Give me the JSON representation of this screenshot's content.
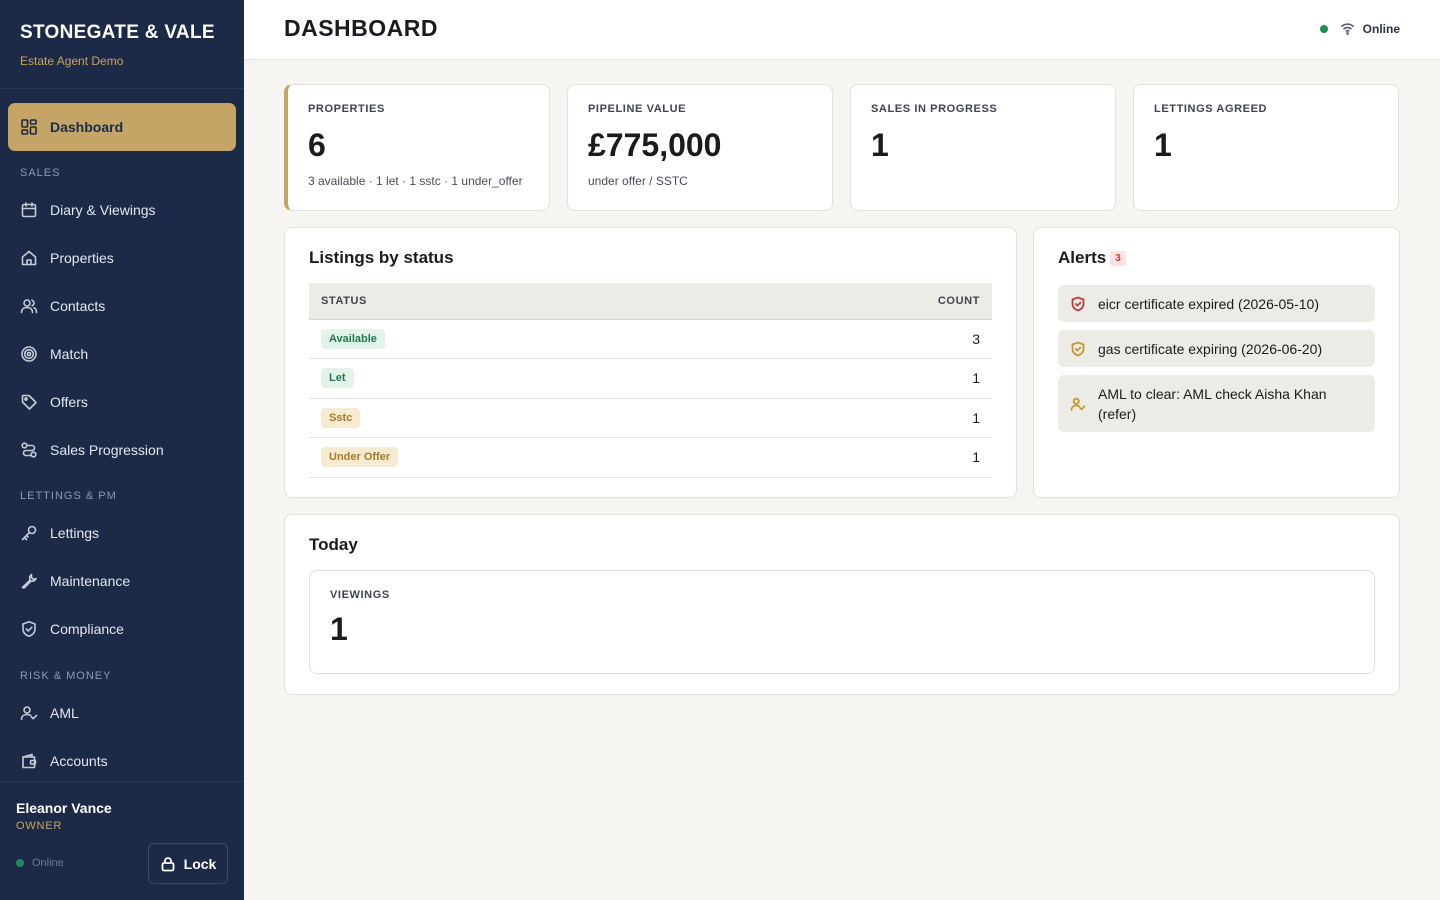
{
  "brand": {
    "title": "STONEGATE & VALE",
    "subtitle": "Estate Agent Demo"
  },
  "nav": {
    "dashboard": "Dashboard",
    "sales_section": "SALES",
    "diary": "Diary & Viewings",
    "properties": "Properties",
    "contacts": "Contacts",
    "match": "Match",
    "offers": "Offers",
    "sales_progression": "Sales Progression",
    "lettings_section": "LETTINGS & PM",
    "lettings": "Lettings",
    "maintenance": "Maintenance",
    "compliance": "Compliance",
    "risk_section": "RISK & MONEY",
    "aml": "AML",
    "accounts": "Accounts"
  },
  "user": {
    "name": "Eleanor Vance",
    "role": "OWNER",
    "status": "Online",
    "lock_label": "Lock"
  },
  "header": {
    "title": "DASHBOARD",
    "status": "Online"
  },
  "stats": {
    "properties": {
      "label": "PROPERTIES",
      "value": "6",
      "sub": "3 available · 1 let · 1 sstc · 1 under_offer"
    },
    "pipeline": {
      "label": "PIPELINE VALUE",
      "value": "£775,000",
      "sub": "under offer / SSTC"
    },
    "sales": {
      "label": "SALES IN PROGRESS",
      "value": "1"
    },
    "lettings": {
      "label": "LETTINGS AGREED",
      "value": "1"
    }
  },
  "listings": {
    "title": "Listings by status",
    "col_status": "STATUS",
    "col_count": "COUNT",
    "rows": [
      {
        "status": "Available",
        "count": "3"
      },
      {
        "status": "Let",
        "count": "1"
      },
      {
        "status": "Sstc",
        "count": "1"
      },
      {
        "status": "Under Offer",
        "count": "1"
      }
    ]
  },
  "alerts": {
    "title": "Alerts",
    "count": "3",
    "items": [
      {
        "text": "eicr certificate expired (2026-05-10)",
        "icon": "shield-alert-icon",
        "color": "#c23b3b"
      },
      {
        "text": "gas certificate expiring (2026-06-20)",
        "icon": "shield-warning-icon",
        "color": "#c9942e"
      },
      {
        "text": "AML to clear: AML check Aisha Khan (refer)",
        "icon": "user-check-icon",
        "color": "#c9942e"
      }
    ]
  },
  "today": {
    "title": "Today",
    "viewings_label": "VIEWINGS",
    "viewings_value": "1"
  },
  "colors": {
    "sidebar": "#1c2a47",
    "accent": "#c4a566",
    "online": "#1f8a5a"
  }
}
